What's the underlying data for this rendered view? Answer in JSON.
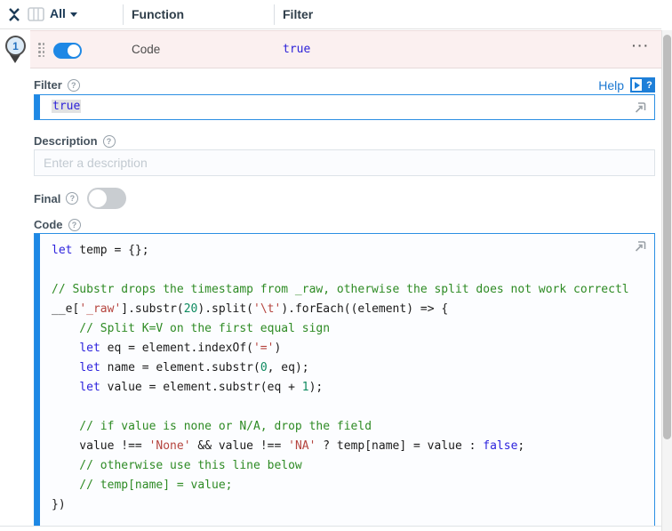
{
  "header": {
    "all_label": "All",
    "function_col": "Function",
    "filter_col": "Filter"
  },
  "function_row": {
    "index": "1",
    "name": "Code",
    "filter_value": "true",
    "enabled": true,
    "menu_label": "···"
  },
  "filter_field": {
    "label": "Filter",
    "value": "true",
    "help_label": "Help"
  },
  "description_field": {
    "label": "Description",
    "placeholder": "Enter a description"
  },
  "final_field": {
    "label": "Final",
    "enabled": false
  },
  "code_field": {
    "label": "Code",
    "lines": [
      [
        {
          "c": "kw",
          "t": "let"
        },
        {
          "c": "p",
          "t": " temp = {};"
        }
      ],
      [],
      [
        {
          "c": "com",
          "t": "// Substr drops the timestamp from _raw, otherwise the split does not work correctl"
        }
      ],
      [
        {
          "c": "p",
          "t": "__e["
        },
        {
          "c": "str",
          "t": "'_raw'"
        },
        {
          "c": "p",
          "t": "].substr("
        },
        {
          "c": "num",
          "t": "20"
        },
        {
          "c": "p",
          "t": ").split("
        },
        {
          "c": "str",
          "t": "'\\t'"
        },
        {
          "c": "p",
          "t": ").forEach((element) => {"
        }
      ],
      [
        {
          "c": "com",
          "t": "    // Split K=V on the first equal sign"
        }
      ],
      [
        {
          "c": "p",
          "t": "    "
        },
        {
          "c": "kw",
          "t": "let"
        },
        {
          "c": "p",
          "t": " eq = element.indexOf("
        },
        {
          "c": "str",
          "t": "'='"
        },
        {
          "c": "p",
          "t": ")"
        }
      ],
      [
        {
          "c": "p",
          "t": "    "
        },
        {
          "c": "kw",
          "t": "let"
        },
        {
          "c": "p",
          "t": " name = element.substr("
        },
        {
          "c": "num",
          "t": "0"
        },
        {
          "c": "p",
          "t": ", eq);"
        }
      ],
      [
        {
          "c": "p",
          "t": "    "
        },
        {
          "c": "kw",
          "t": "let"
        },
        {
          "c": "p",
          "t": " value = element.substr(eq + "
        },
        {
          "c": "num",
          "t": "1"
        },
        {
          "c": "p",
          "t": ");"
        }
      ],
      [],
      [
        {
          "c": "com",
          "t": "    // if value is none or N/A, drop the field"
        }
      ],
      [
        {
          "c": "p",
          "t": "    value !== "
        },
        {
          "c": "str",
          "t": "'None'"
        },
        {
          "c": "p",
          "t": " && value !== "
        },
        {
          "c": "str",
          "t": "'NA'"
        },
        {
          "c": "p",
          "t": " ? temp[name] = value : "
        },
        {
          "c": "kw",
          "t": "false"
        },
        {
          "c": "p",
          "t": ";"
        }
      ],
      [
        {
          "c": "com",
          "t": "    // otherwise use this line below"
        }
      ],
      [
        {
          "c": "com",
          "t": "    // temp[name] = value;"
        }
      ],
      [
        {
          "c": "p",
          "t": "})"
        }
      ]
    ]
  },
  "colors": {
    "accent_blue": "#1e88e5",
    "row_pink": "#fbf0f0",
    "keyword": "#2d23dd",
    "comment": "#2e8b24",
    "string": "#b5443e",
    "number": "#0d8a5f",
    "help_blue": "#1d79d2"
  }
}
